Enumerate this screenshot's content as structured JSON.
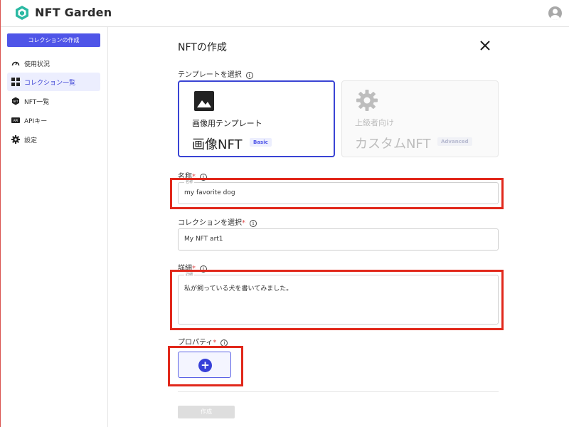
{
  "app": {
    "brand": "NFT Garden"
  },
  "sidebar": {
    "create_button": "コレクションの作成",
    "items": [
      {
        "label": "使用状況",
        "icon": "gauge-icon"
      },
      {
        "label": "コレクション一覧",
        "icon": "grid-icon",
        "active": true
      },
      {
        "label": "NFT一覧",
        "icon": "nft-hex-icon"
      },
      {
        "label": "APIキー",
        "icon": "api-icon"
      },
      {
        "label": "設定",
        "icon": "gear-icon"
      }
    ]
  },
  "dialog": {
    "title": "NFTの作成",
    "template_label": "テンプレートを選択",
    "templates": [
      {
        "sub": "画像用テンプレート",
        "name": "画像NFT",
        "badge": "Basic",
        "selected": true
      },
      {
        "sub": "上級者向け",
        "name": "カスタムNFT",
        "badge": "Advanced",
        "selected": false
      }
    ],
    "name_label": "名称",
    "name_float": "名称",
    "name_value": "my favorite dog",
    "collection_label": "コレクションを選択",
    "collection_value": "My NFT art1",
    "detail_label": "詳細",
    "detail_float": "詳細",
    "detail_value": "私が飼っている犬を書いてみました。",
    "property_label": "プロパティ",
    "add_property_glyph": "+",
    "submit_label": "作成",
    "required_mark": "*",
    "info_glyph": "i"
  },
  "colors": {
    "primary": "#4f55e8",
    "highlight": "#e1281b",
    "required": "#e04b4b"
  }
}
